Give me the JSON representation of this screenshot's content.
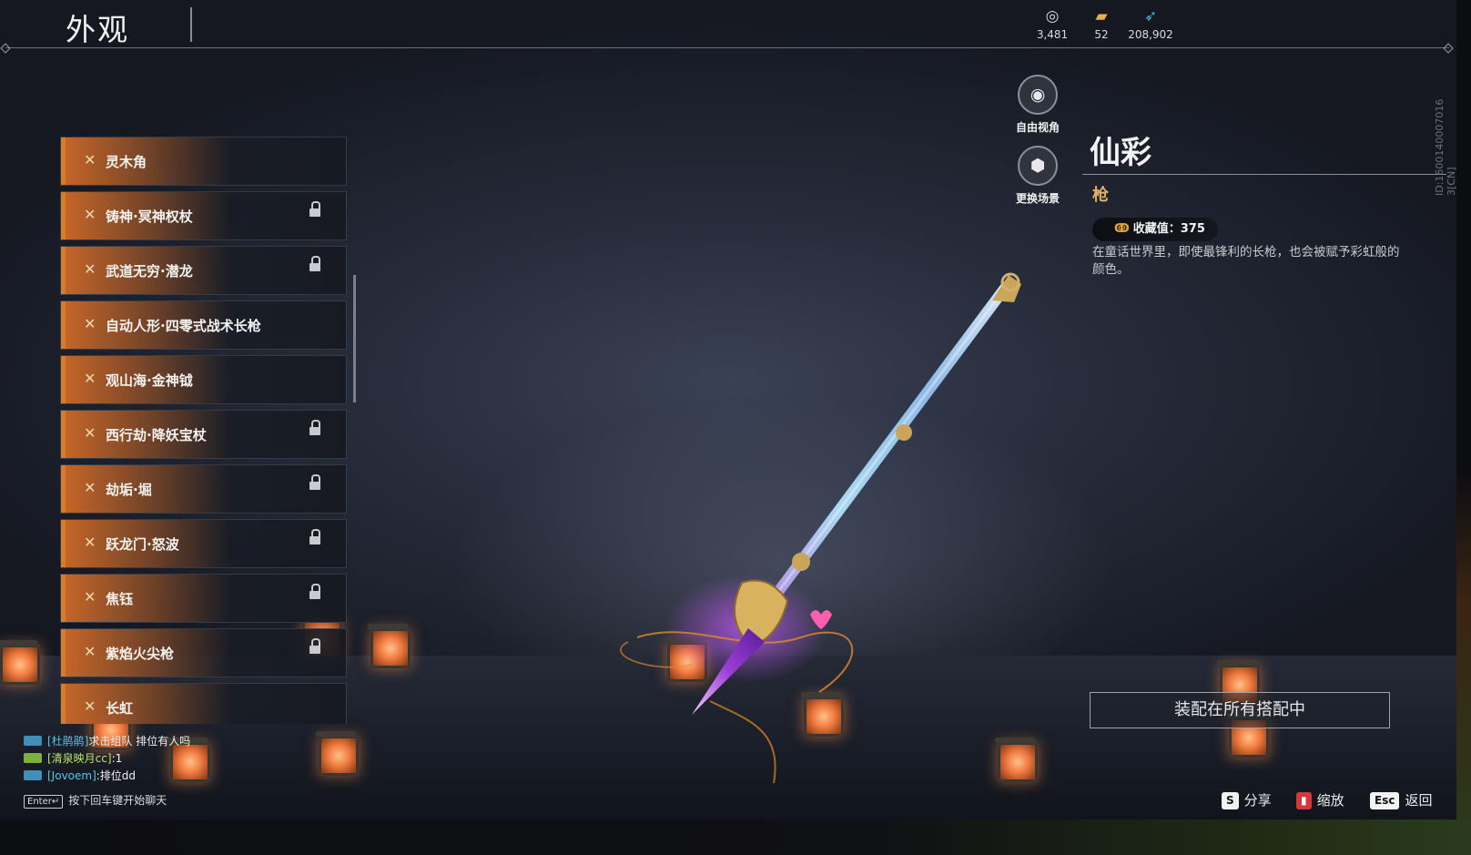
{
  "header": {
    "title": "外观",
    "currencies": [
      {
        "icon": "coin-stack-icon",
        "value": "3,481"
      },
      {
        "icon": "ticket-icon",
        "value": "52"
      },
      {
        "icon": "feather-icon",
        "value": "208,902"
      }
    ]
  },
  "skin_list": {
    "items": [
      {
        "label": "灵木角",
        "locked": false
      },
      {
        "label": "铸神·冥神权杖",
        "locked": true
      },
      {
        "label": "武道无穷·潜龙",
        "locked": true
      },
      {
        "label": "自动人形·四零式战术长枪",
        "locked": false
      },
      {
        "label": "观山海·金神钺",
        "locked": false
      },
      {
        "label": "西行劫·降妖宝杖",
        "locked": true
      },
      {
        "label": "劫垢·堀",
        "locked": true
      },
      {
        "label": "跃龙门·怒波",
        "locked": true
      },
      {
        "label": "焦钰",
        "locked": true
      },
      {
        "label": "紫焰火尖枪",
        "locked": true
      },
      {
        "label": "长虹",
        "locked": false
      }
    ]
  },
  "view_controls": {
    "free_camera": "自由视角",
    "change_scene": "更换场景"
  },
  "detail": {
    "name": "仙彩",
    "type": "枪",
    "collection_label": "收藏值：375",
    "description": "在童话世界里，即使最锋利的长枪，也会被赋予彩虹般的颜色。",
    "id_text": "ID:1600140007016 3[CN]"
  },
  "equip_button": "装配在所有搭配中",
  "hints": {
    "share_key": "S",
    "share": "分享",
    "zoom": "缩放",
    "back_key": "Esc",
    "back": "返回"
  },
  "chat": {
    "lines": [
      {
        "name": "[杜鹃鹃]",
        "name_color": "#55c5e8",
        "message": "求击组队 排位有人吗"
      },
      {
        "name": "[清泉映月cc]",
        "name_color": "#b9e66a",
        "message": ":1"
      },
      {
        "name": "[Jovoem]",
        "name_color": "#55c5e8",
        "message": ":排位dd"
      }
    ],
    "enter_key": "Enter↵",
    "input_hint": "按下回车键开始聊天"
  },
  "colors": {
    "accent_orange": "#d67d2c",
    "gold": "#e2b362"
  }
}
